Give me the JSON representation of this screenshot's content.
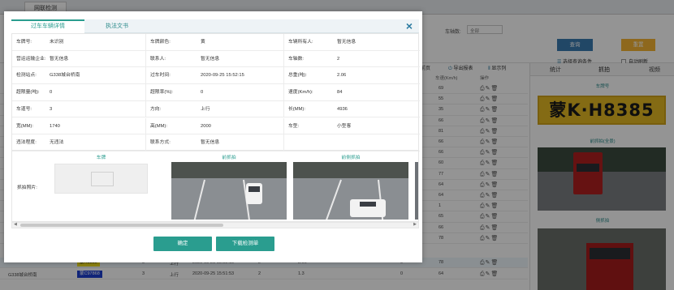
{
  "app": {
    "tab_label": "网联检测"
  },
  "filter": {
    "axle_label": "车轴数:",
    "axle_value": "全部",
    "query_label": "查询",
    "reset_label": "重置",
    "more_filters_label": "选择查询条件",
    "auto_refresh_label": "自动刷新"
  },
  "toolbar": {
    "export_label": "导出报表",
    "columns_label": "显示列",
    "page_label": "当前页"
  },
  "table": {
    "speed_header": "车速(Km/h)",
    "ops_header": "操作",
    "speed_values": [
      "69",
      "55",
      "35",
      "66",
      "81",
      "66",
      "66",
      "60",
      "77",
      "64",
      "64",
      "1",
      "65",
      "66",
      "78"
    ],
    "bottom_rows": [
      {
        "station": "",
        "plate": "蒙H8385",
        "axles": "3",
        "lane": "上行",
        "time": "2020-09-25 15:52:15",
        "count": "2",
        "weight": "2.06",
        "extra": "0",
        "speed": "78"
      },
      {
        "station": "G338城台桥南",
        "plate": "蒙C97868",
        "axles": "3",
        "lane": "上行",
        "time": "2020-09-25 15:51:53",
        "count": "2",
        "weight": "1.3",
        "extra": "0",
        "speed": "64"
      }
    ]
  },
  "right_panel": {
    "tabs": [
      "统计",
      "抓拍",
      "视频"
    ],
    "plate_section_title": "车牌号",
    "plate_text": "蒙K·H8385",
    "front_section_title": "前抓拍(全景)",
    "side_section_title": "侧抓拍"
  },
  "modal": {
    "tabs": [
      "过车车辆详情",
      "执法文书"
    ],
    "close_icon": "×",
    "fields": [
      [
        "车牌号:",
        "未识别",
        "车牌颜色:",
        "黄",
        "车辆所有人:",
        "暂无信息"
      ],
      [
        "营运运输企业:",
        "暂无信息",
        "联系人:",
        "暂无信息",
        "车轴数:",
        "2"
      ],
      [
        "检测站点:",
        "G338城台桥南",
        "过车时间:",
        "2020-09-25 15:52:15",
        "总重(吨):",
        "2.06"
      ],
      [
        "超限量(吨):",
        "0",
        "超限率(%):",
        "0",
        "速度(Km/h):",
        "84"
      ],
      [
        "车道号:",
        "3",
        "方向:",
        "上行",
        "长(MM):",
        "4936"
      ],
      [
        "宽(MM):",
        "1740",
        "高(MM):",
        "2000",
        "车型:",
        "小型客"
      ],
      [
        "违法程度:",
        "无违法",
        "联系方式:",
        "暂无信息",
        "",
        ""
      ]
    ],
    "image_label": "抓拍照片:",
    "image_heads": [
      "车牌",
      "前抓拍",
      "前侧抓拍"
    ],
    "ok_label": "确定",
    "download_label": "下载检测单"
  }
}
